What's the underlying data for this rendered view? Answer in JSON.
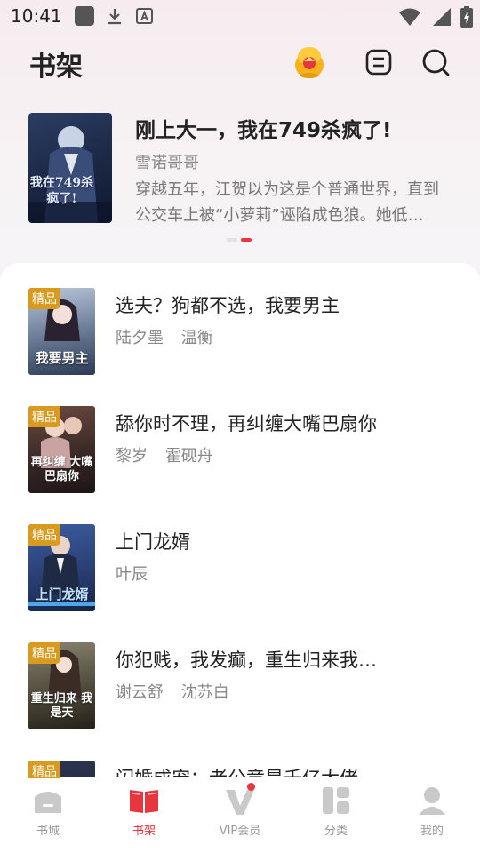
{
  "status_bar": {
    "time": "10:41"
  },
  "header": {
    "title": "书架"
  },
  "featured": {
    "title": "刚上大一，我在749杀疯了!",
    "author": "雪诺哥哥",
    "description": "穿越五年，江贺以为这是个普通世界，直到公交车上被“小萝莉”诬陷成色狼。她低…",
    "cover_text": "我在749杀疯了!"
  },
  "books": [
    {
      "badge": "精品",
      "title": "选夫？狗都不选，我要男主",
      "authors": [
        "陆夕墨",
        "温衡"
      ],
      "cover_text": "我要男主"
    },
    {
      "badge": "精品",
      "title": "舔你时不理，再纠缠大嘴巴扇你",
      "authors": [
        "黎岁",
        "霍砚舟"
      ],
      "cover_text": "再纠缠 大嘴巴扇你"
    },
    {
      "badge": "精品",
      "title": "上门龙婿",
      "authors": [
        "叶辰"
      ],
      "cover_text": "上门龙婿"
    },
    {
      "badge": "精品",
      "title": "你犯贱，我发癫，重生归来我…",
      "authors": [
        "谢云舒",
        "沈苏白"
      ],
      "cover_text": "重生归来 我是天"
    },
    {
      "badge": "精品",
      "title": "闪婚成宠：老公竟是千亿大佬",
      "authors": [],
      "cover_text": ""
    }
  ],
  "nav": {
    "items": [
      {
        "label": "书城",
        "icon": "bookstore-icon",
        "active": false
      },
      {
        "label": "书架",
        "icon": "bookshelf-icon",
        "active": true
      },
      {
        "label": "VIP会员",
        "icon": "vip-icon",
        "active": false,
        "has_dot": true
      },
      {
        "label": "分类",
        "icon": "category-icon",
        "active": false
      },
      {
        "label": "我的",
        "icon": "profile-icon",
        "active": false
      }
    ]
  },
  "colors": {
    "accent": "#e8363e",
    "badge": "#d89a1f",
    "muted": "#888888"
  }
}
